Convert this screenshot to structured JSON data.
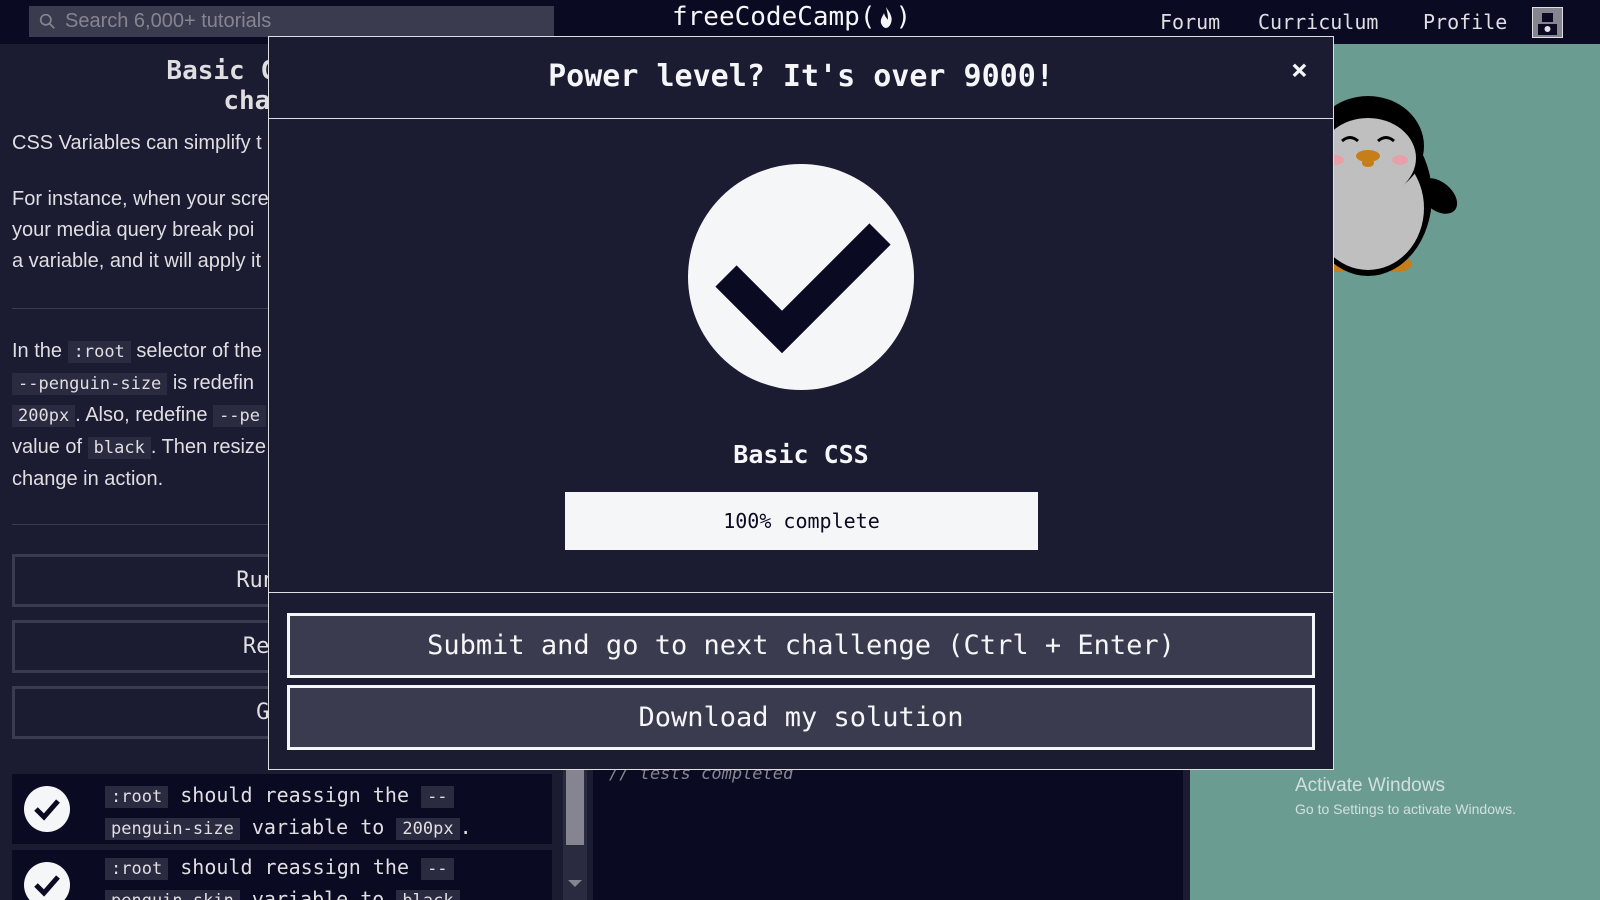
{
  "navbar": {
    "search_placeholder": "Search 6,000+ tutorials",
    "logo_text": "freeCodeCamp(",
    "logo_end": ")",
    "links": [
      "Forum",
      "Curriculum",
      "Profile"
    ]
  },
  "lesson": {
    "title_line1": "Basic CSS: Use",
    "title_line2": "change a",
    "p1": "CSS Variables can simplify t",
    "p2_line1": "For instance, when your scre",
    "p2_line2": "your media query break poi",
    "p2_line3": "a variable, and it will apply it",
    "p3_a": "In the",
    "p3_root": ":root",
    "p3_b": "selector of the",
    "p3_penguin_size": "--penguin-size",
    "p3_c": "is redefin",
    "p3_200px": "200px",
    "p3_d": ". Also, redefine",
    "p3_pe": "--pe",
    "p3_e": "value of",
    "p3_black": "black",
    "p3_f": ". Then resize",
    "p3_g": "change in action.",
    "buttons": [
      "Run th",
      "Reset",
      "Get"
    ],
    "tests": [
      {
        "a": ":root",
        "b": "should reassign the",
        "c": "--",
        "d": "penguin-size",
        "e": "variable to",
        "f": "200px",
        "g": "."
      },
      {
        "a": ":root",
        "b": "should reassign the",
        "c": "--",
        "d": "penguin-skin",
        "e": "variable to",
        "f": "black"
      }
    ]
  },
  "console": {
    "text": "// tests completed"
  },
  "watermark": {
    "line1": "Activate Windows",
    "line2": "Go to Settings to activate Windows."
  },
  "modal": {
    "title": "Power level? It's over 9000!",
    "close": "×",
    "cert_name": "Basic CSS",
    "progress_label": "100% complete",
    "progress_value": 1.0,
    "submit_label": "Submit and go to next challenge (Ctrl + Enter)",
    "download_label": "Download my solution"
  },
  "colors": {
    "background": "#1b1b32",
    "navbar": "#0a0a23",
    "preview": "#6b9c92",
    "button": "#3b3b4f"
  }
}
